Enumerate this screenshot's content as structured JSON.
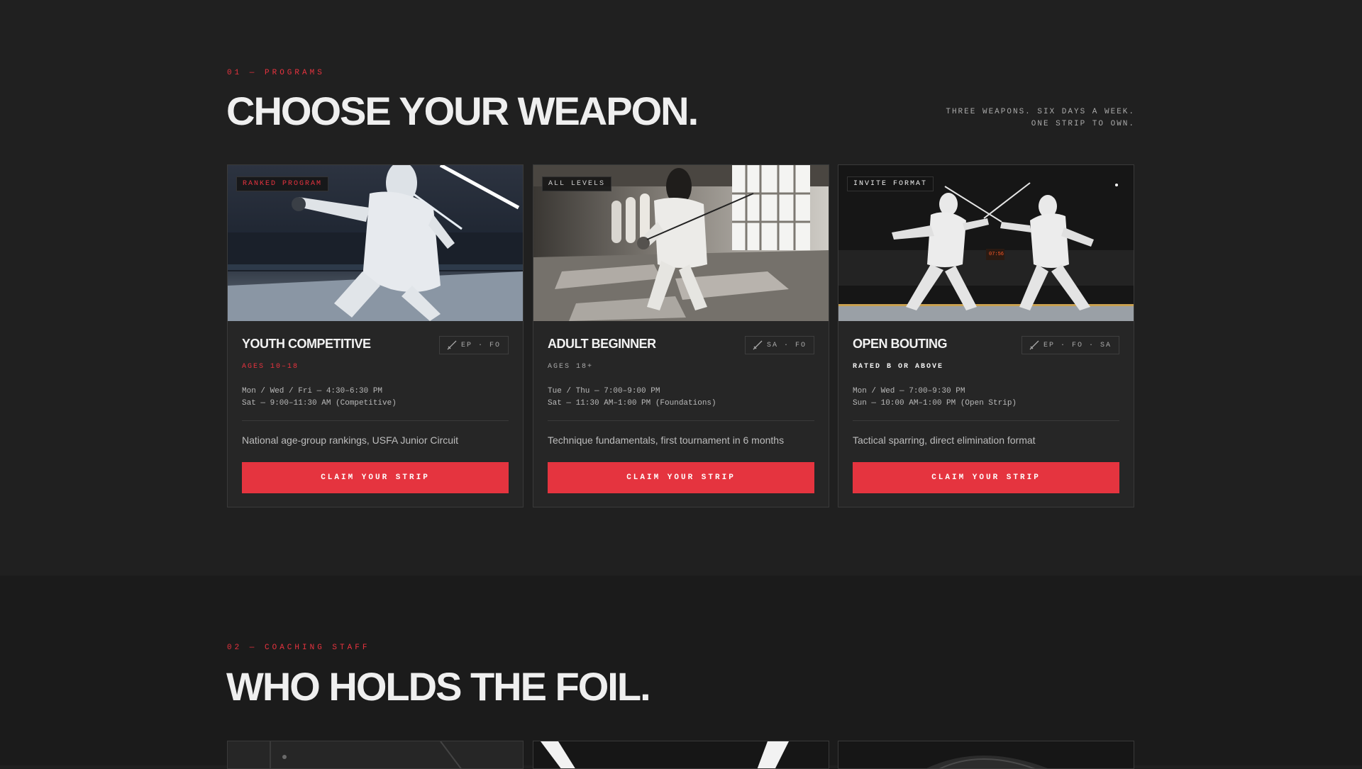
{
  "programs": {
    "eyebrow": "01 — PROGRAMS",
    "headline": "CHOOSE YOUR WEAPON.",
    "tagline_line1": "THREE WEAPONS. SIX DAYS A WEEK.",
    "tagline_line2": "ONE STRIP TO OWN.",
    "cards": [
      {
        "badge": "RANKED PROGRAM",
        "title": "YOUTH COMPETITIVE",
        "weapons": "EP · FO",
        "ages": "AGES 10–18",
        "schedule_line1": "Mon / Wed / Fri — 4:30–6:30 PM",
        "schedule_line2": "Sat — 9:00–11:30 AM (Competitive)",
        "description": "National age-group rankings, USFA Junior Circuit",
        "cta": "CLAIM YOUR STRIP"
      },
      {
        "badge": "ALL LEVELS",
        "title": "ADULT BEGINNER",
        "weapons": "SA · FO",
        "ages": "AGES 18+",
        "schedule_line1": "Tue / Thu — 7:00–9:00 PM",
        "schedule_line2": "Sat — 11:30 AM–1:00 PM (Foundations)",
        "description": "Technique fundamentals, first tournament in 6 months",
        "cta": "CLAIM YOUR STRIP"
      },
      {
        "badge": "INVITE FORMAT",
        "title": "OPEN BOUTING",
        "weapons": "EP · FO · SA",
        "ages": "RATED B OR ABOVE",
        "schedule_line1": "Mon / Wed — 7:00–9:30 PM",
        "schedule_line2": "Sun — 10:00 AM–1:00 PM (Open Strip)",
        "description": "Tactical sparring, direct elimination format",
        "cta": "CLAIM YOUR STRIP"
      }
    ]
  },
  "coaching": {
    "eyebrow": "02 — COACHING STAFF",
    "headline": "WHO HOLDS THE FOIL."
  },
  "colors": {
    "accent": "#e5343f",
    "background": "#202020",
    "card": "#262626"
  },
  "icons": {
    "weapon": "sword-icon"
  }
}
